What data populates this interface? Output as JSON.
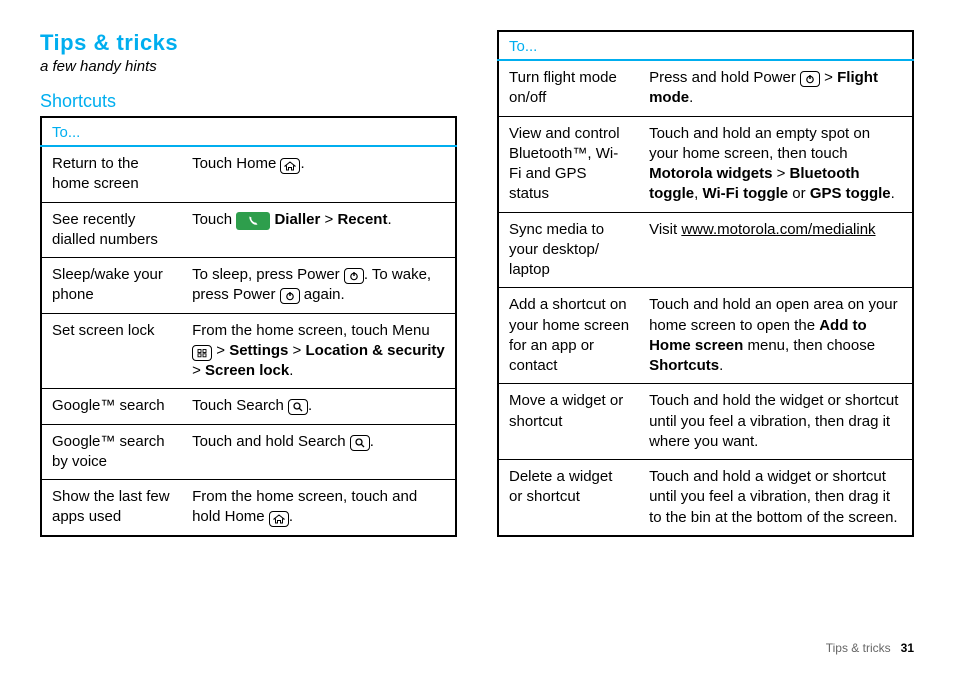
{
  "title": "Tips & tricks",
  "subtitle": "a few handy hints",
  "section": "Shortcuts",
  "header": "To...",
  "rows_left": [
    {
      "to": "Return to the home screen",
      "act": [
        {
          "t": "Touch Home "
        },
        {
          "icon": "home"
        },
        {
          "t": "."
        }
      ]
    },
    {
      "to": "See recently dialled numbers",
      "act": [
        {
          "t": "Touch "
        },
        {
          "icon": "dialler"
        },
        {
          "t": " "
        },
        {
          "b": "Dialler"
        },
        {
          "t": " > "
        },
        {
          "b": "Recent"
        },
        {
          "t": "."
        }
      ]
    },
    {
      "to": "Sleep/wake your phone",
      "act": [
        {
          "t": "To sleep, press Power "
        },
        {
          "icon": "power"
        },
        {
          "t": ". To wake, press Power "
        },
        {
          "icon": "power"
        },
        {
          "t": " again."
        }
      ]
    },
    {
      "to": "Set screen lock",
      "act": [
        {
          "t": "From the home screen, touch Menu "
        },
        {
          "icon": "menu"
        },
        {
          "t": " > "
        },
        {
          "b": "Settings"
        },
        {
          "t": " > "
        },
        {
          "b": "Location & security"
        },
        {
          "t": " > "
        },
        {
          "b": "Screen lock"
        },
        {
          "t": "."
        }
      ]
    },
    {
      "to": "Google™ search",
      "act": [
        {
          "t": "Touch Search "
        },
        {
          "icon": "search"
        },
        {
          "t": "."
        }
      ]
    },
    {
      "to": "Google™ search by voice",
      "act": [
        {
          "t": "Touch and hold Search "
        },
        {
          "icon": "search"
        },
        {
          "t": "."
        }
      ]
    },
    {
      "to": "Show the last few apps used",
      "act": [
        {
          "t": "From the home screen, touch and hold Home "
        },
        {
          "icon": "home"
        },
        {
          "t": "."
        }
      ]
    }
  ],
  "rows_right": [
    {
      "to": "Turn flight mode on/off",
      "act": [
        {
          "t": "Press and hold Power "
        },
        {
          "icon": "power"
        },
        {
          "t": " > "
        },
        {
          "b": "Flight mode"
        },
        {
          "t": "."
        }
      ]
    },
    {
      "to": "View and control Bluetooth™, Wi-Fi and GPS status",
      "act": [
        {
          "t": "Touch and hold an empty spot on your home screen, then touch "
        },
        {
          "b": "Motorola widgets"
        },
        {
          "t": " > "
        },
        {
          "b": "Bluetooth toggle"
        },
        {
          "t": ", "
        },
        {
          "b": "Wi-Fi toggle"
        },
        {
          "t": " or "
        },
        {
          "b": "GPS toggle"
        },
        {
          "t": "."
        }
      ]
    },
    {
      "to": "Sync media to your desktop/ laptop",
      "act": [
        {
          "t": "Visit "
        },
        {
          "link": "www.motorola.com/medialink"
        }
      ]
    },
    {
      "to": "Add a shortcut on your home screen for an app or contact",
      "act": [
        {
          "t": "Touch and hold an open area on your home screen to open the "
        },
        {
          "b": "Add to Home screen"
        },
        {
          "t": " menu, then choose "
        },
        {
          "b": "Shortcuts"
        },
        {
          "t": "."
        }
      ]
    },
    {
      "to": "Move a widget or shortcut",
      "act": [
        {
          "t": "Touch and hold the widget or shortcut until you feel a vibration, then drag it where you want."
        }
      ]
    },
    {
      "to": "Delete a widget or shortcut",
      "act": [
        {
          "t": "Touch and hold a widget or shortcut until you feel a vibration, then drag it to the bin at the bottom of the screen."
        }
      ]
    }
  ],
  "footer_label": "Tips & tricks",
  "page_number": "31"
}
